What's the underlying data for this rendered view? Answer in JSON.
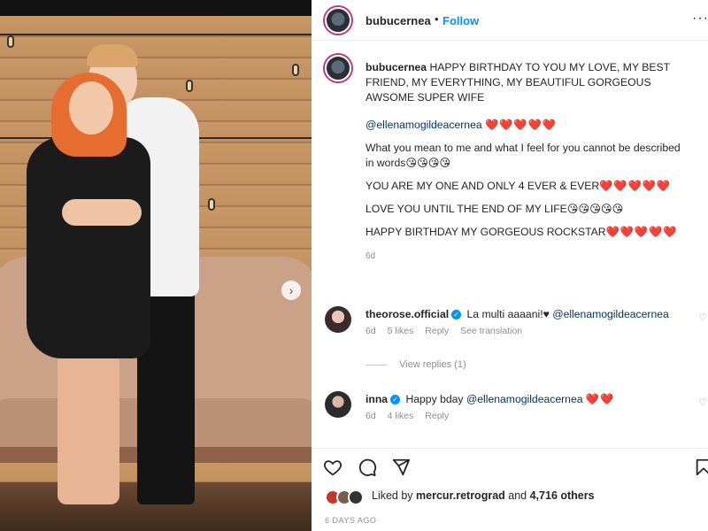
{
  "post": {
    "username": "bubucernea",
    "follow_label": "Follow",
    "more_label": "···",
    "dot": "•"
  },
  "caption": {
    "username": "bubucernea",
    "line1": "HAPPY BIRTHDAY TO YOU MY LOVE, MY BEST FRIEND, MY EVERYTHING, MY BEAUTIFUL GORGEOUS AWSOME SUPER WIFE",
    "mention": "@ellenamogildeacernea",
    "mention_hearts": "❤️❤️❤️❤️❤️",
    "line3": "What you mean to me and what I feel for you cannot be described in words",
    "line3_emoji": "😘😘😘😘",
    "line4": "YOU ARE MY ONE AND ONLY 4 EVER & EVER",
    "line4_hearts": "❤️❤️❤️❤️❤️",
    "line5": "LOVE YOU UNTIL THE END OF MY LIFE",
    "line5_emoji": "😘😘😘😘😘",
    "line6": "HAPPY BIRTHDAY MY GORGEOUS ROCKSTAR",
    "line6_hearts": "❤️❤️❤️❤️❤️",
    "time": "6d"
  },
  "comments": [
    {
      "username": "theorose.official",
      "text": "La multi aaaani!♥",
      "mention": "@ellenamogildeacernea",
      "time": "6d",
      "likes": "5 likes",
      "reply": "Reply",
      "translate": "See translation"
    },
    {
      "username": "inna",
      "text": "Happy bday",
      "mention": "@ellenamogildeacernea",
      "hearts": "❤️❤️",
      "time": "6d",
      "likes": "4 likes",
      "reply": "Reply"
    }
  ],
  "view_replies": "View replies (1)",
  "likes": {
    "prefix": "Liked by",
    "user": "mercur.retrograd",
    "and": "and",
    "others": "4,716 others"
  },
  "posted": "6 DAYS AGO",
  "icons": {
    "like": "heart-icon",
    "comment": "comment-icon",
    "share": "share-icon",
    "save": "bookmark-icon",
    "carousel_next": "chevron-right-icon"
  },
  "colors": {
    "accent": "#0095f6",
    "heart": "#e0245e",
    "muted": "#8e8e8e"
  }
}
